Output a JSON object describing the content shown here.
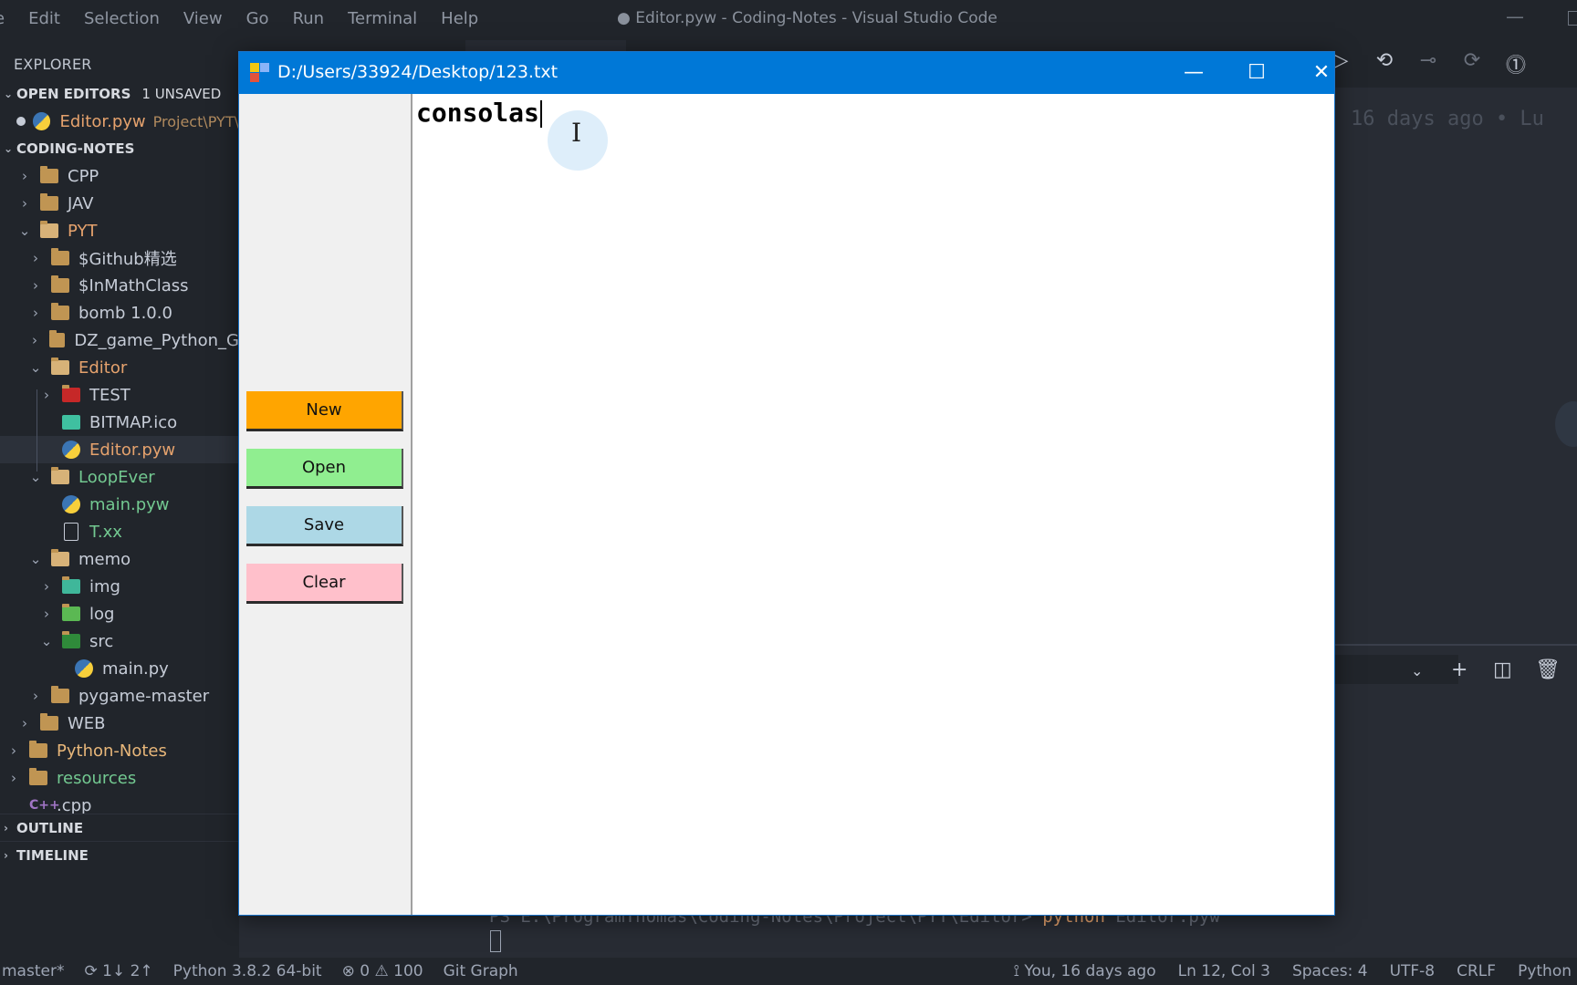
{
  "vscode": {
    "menu": [
      "e",
      "Edit",
      "Selection",
      "View",
      "Go",
      "Run",
      "Terminal",
      "Help"
    ],
    "window_title": "● Editor.pyw - Coding-Notes - Visual Studio Code",
    "editor_ghost_text": "16 days ago • Lu",
    "terminal": {
      "line_prefix": "PS E:\\ProgramThomas\\Coding-Notes\\Project\\PYT\\Editor> ",
      "command": "python",
      "arg": " Editor.pyw"
    }
  },
  "sidebar": {
    "header": "EXPLORER",
    "open_editors": {
      "label": "OPEN EDITORS",
      "badge": "1 UNSAVED"
    },
    "open_file": {
      "name": "Editor.pyw",
      "path": "Project\\PYT\\"
    },
    "workspace": "CODING-NOTES",
    "tree": [
      {
        "label": "CPP",
        "type": "folder",
        "depth": 1,
        "expanded": false,
        "color": "white"
      },
      {
        "label": "JAV",
        "type": "folder",
        "depth": 1,
        "expanded": false,
        "color": "white"
      },
      {
        "label": "PYT",
        "type": "folder",
        "depth": 1,
        "expanded": true,
        "color": "orange"
      },
      {
        "label": "$Github精选",
        "type": "folder",
        "depth": 2,
        "expanded": false,
        "color": "white"
      },
      {
        "label": "$InMathClass",
        "type": "folder",
        "depth": 2,
        "expanded": false,
        "color": "white"
      },
      {
        "label": "bomb 1.0.0",
        "type": "folder",
        "depth": 2,
        "expanded": false,
        "color": "white"
      },
      {
        "label": "DZ_game_Python_G",
        "type": "folder",
        "depth": 2,
        "expanded": false,
        "color": "white"
      },
      {
        "label": "Editor",
        "type": "folder",
        "depth": 2,
        "expanded": true,
        "color": "orange"
      },
      {
        "label": "TEST",
        "type": "folder-test",
        "depth": 3,
        "expanded": false,
        "color": "white"
      },
      {
        "label": "BITMAP.ico",
        "type": "image",
        "depth": 3,
        "color": "white"
      },
      {
        "label": "Editor.pyw",
        "type": "python",
        "depth": 3,
        "color": "orange",
        "selected": true
      },
      {
        "label": "LoopEver",
        "type": "folder",
        "depth": 2,
        "expanded": true,
        "color": "green"
      },
      {
        "label": "main.pyw",
        "type": "python",
        "depth": 3,
        "color": "green"
      },
      {
        "label": "T.xx",
        "type": "file",
        "depth": 3,
        "color": "green"
      },
      {
        "label": "memo",
        "type": "folder",
        "depth": 2,
        "expanded": true,
        "color": "white"
      },
      {
        "label": "img",
        "type": "folder-img",
        "depth": 3,
        "expanded": false,
        "color": "white"
      },
      {
        "label": "log",
        "type": "folder-log",
        "depth": 3,
        "expanded": false,
        "color": "white"
      },
      {
        "label": "src",
        "type": "folder-src",
        "depth": 3,
        "expanded": true,
        "color": "white"
      },
      {
        "label": "main.py",
        "type": "python",
        "depth": 4,
        "color": "white"
      },
      {
        "label": "pygame-master",
        "type": "folder",
        "depth": 2,
        "expanded": false,
        "color": "white"
      },
      {
        "label": "WEB",
        "type": "folder",
        "depth": 1,
        "expanded": false,
        "color": "white"
      },
      {
        "label": "Python-Notes",
        "type": "folder",
        "depth": 0,
        "expanded": false,
        "color": "orange-light"
      },
      {
        "label": "resources",
        "type": "folder",
        "depth": 0,
        "expanded": false,
        "color": "green"
      },
      {
        "label": ".cpp",
        "type": "cpp",
        "depth": 0,
        "color": "white"
      }
    ],
    "outline": "OUTLINE",
    "timeline": "TIMELINE"
  },
  "statusbar": {
    "branch": "master*",
    "sync": "1↓ 2↑",
    "interpreter": "Python 3.8.2 64-bit",
    "errors": "0",
    "warnings": "100",
    "git_graph": "Git Graph",
    "blame": "You, 16 days ago",
    "position": "Ln 12, Col 3",
    "spaces": "Spaces: 4",
    "encoding": "UTF-8",
    "eol": "CRLF",
    "language": "Python"
  },
  "tk_app": {
    "title": "D:/Users/33924/Desktop/123.txt",
    "buttons": [
      {
        "label": "New",
        "color": "#ffa500"
      },
      {
        "label": "Open",
        "color": "#90ee90"
      },
      {
        "label": "Save",
        "color": "#add8e6"
      },
      {
        "label": "Clear",
        "color": "#ffc0cb"
      }
    ],
    "text_content": "consolas"
  }
}
